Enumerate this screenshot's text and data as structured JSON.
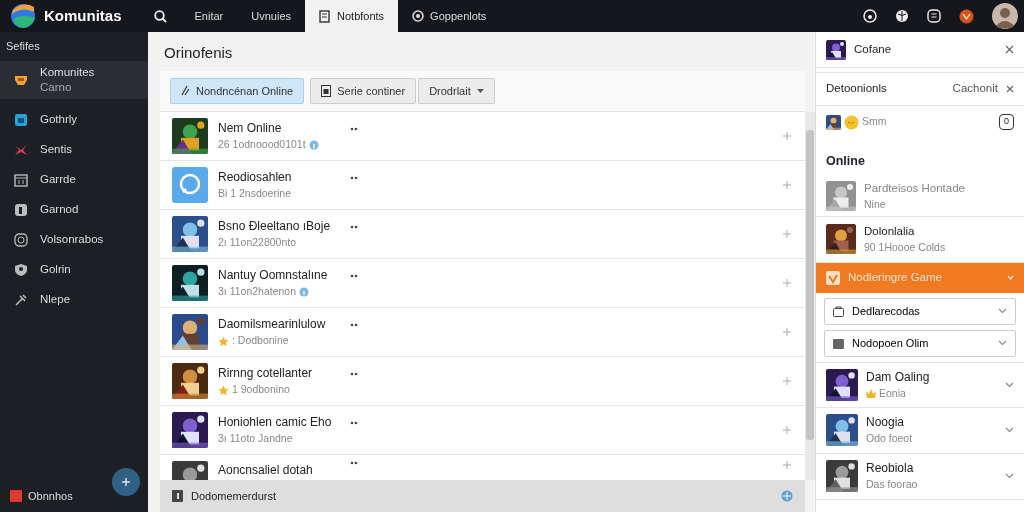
{
  "app": {
    "name": "Komunitas"
  },
  "nav_tabs": [
    {
      "label": "Enitar",
      "selected": false
    },
    {
      "label": "Uvnuies",
      "selected": false
    },
    {
      "label": "Notbfonts",
      "selected": true
    },
    {
      "label": "Goppenlots",
      "selected": false
    }
  ],
  "sidebar": {
    "heading": "Sefifes",
    "items": [
      {
        "label": "Komunites",
        "sublabel": "Carno",
        "selected": true
      },
      {
        "label": "Gothrly",
        "selected": false
      },
      {
        "label": "Sentis",
        "selected": false
      },
      {
        "label": "Garrde",
        "selected": false
      },
      {
        "label": "Garnod",
        "selected": false
      },
      {
        "label": "Volsonrabos",
        "selected": false
      },
      {
        "label": "Golrin",
        "selected": false
      },
      {
        "label": "Nlepe",
        "selected": false
      }
    ],
    "footer": "Obnnhos"
  },
  "main": {
    "title": "Orinofenis",
    "toolbar": [
      {
        "label": "Nondncénan Online",
        "selected": true,
        "caret": false
      },
      {
        "label": "Serie continer",
        "selected": false,
        "caret": false
      },
      {
        "label": "Drodrlait",
        "selected": false,
        "caret": true
      }
    ],
    "rows": [
      {
        "kind": "picture",
        "title": "Nem Online",
        "subtitle": "26 1odnoood0101t",
        "starred": false,
        "verified": true
      },
      {
        "kind": "app",
        "title": "Reodiosahlen",
        "subtitle": "Bi 1 2nsdoerine",
        "starred": false,
        "verified": false
      },
      {
        "kind": "picture",
        "title": "Bsno Ðleeltano ıBoje",
        "subtitle": "2ı 11on22800nto",
        "starred": false,
        "verified": false
      },
      {
        "kind": "picture",
        "title": "Nantuy Oomnstalıne",
        "subtitle": "3ı 11on2hatenon",
        "starred": false,
        "verified": true
      },
      {
        "kind": "picture",
        "title": "Daomilsmearinlulow",
        "subtitle": ": Dodbonine",
        "starred": true,
        "verified": false
      },
      {
        "kind": "picture",
        "title": "Rirnng cotellanter",
        "subtitle": "1 9odbonino",
        "starred": true,
        "verified": false
      },
      {
        "kind": "picture",
        "title": "Honiohlen camic Eho",
        "subtitle": "3ı 11oto Jandne",
        "starred": false,
        "verified": false
      },
      {
        "kind": "picture",
        "title": "Aoncnsaliel dotah"
      }
    ],
    "footer": "Dodomemerdurst"
  },
  "panel": {
    "title": "Cofane",
    "subheader": {
      "label": "Detoonionls",
      "action": "Cachonit"
    },
    "members": {
      "label": "Smm",
      "count": "0"
    },
    "section": "Online",
    "friends": [
      {
        "name": "Pardteisos Hontade",
        "status": "Nine",
        "online": false
      },
      {
        "name": "Dolonlalia",
        "status": "90 1Hoooe Colds",
        "online": true
      }
    ],
    "category": {
      "label": "Nodleringre Game"
    },
    "selects": [
      {
        "value": "Dedlarecodas"
      },
      {
        "value": "Nodopoen Olim"
      }
    ],
    "games": [
      {
        "title": "Dam Oaling",
        "subtitle": "Eonia",
        "featured": true
      },
      {
        "title": "Noogia",
        "subtitle": "Odo foeot",
        "featured": false
      },
      {
        "title": "Reobiola",
        "subtitle": "Das foorao",
        "featured": false
      }
    ]
  }
}
